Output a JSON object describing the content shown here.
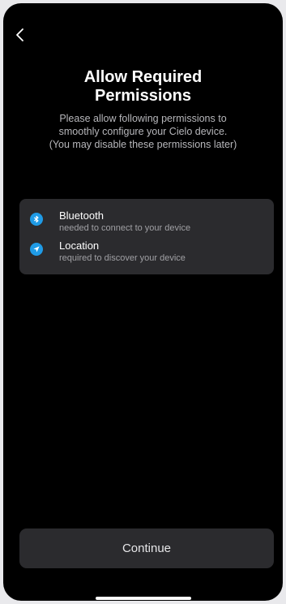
{
  "header": {
    "title": "Allow Required Permissions"
  },
  "intro": {
    "line1": "Please allow following permissions to",
    "line2": "smoothly configure your Cielo device.",
    "line3": "(You may disable these permissions later)"
  },
  "permissions": [
    {
      "icon": "bluetooth-icon",
      "label": "Bluetooth",
      "description": "needed to connect to your device"
    },
    {
      "icon": "location-arrow-icon",
      "label": "Location",
      "description": "required to discover your device"
    }
  ],
  "actions": {
    "continue_label": "Continue"
  },
  "colors": {
    "background": "#000000",
    "card": "#2b2b2e",
    "icon_accent": "#1f9be6",
    "text_primary": "#ffffff",
    "text_secondary": "#a0a0a4"
  }
}
